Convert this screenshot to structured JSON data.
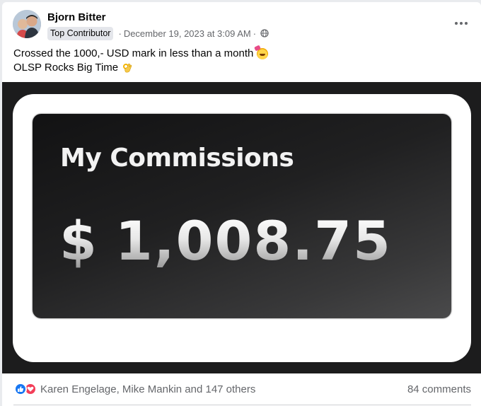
{
  "post": {
    "author": "Bjorn Bitter",
    "badge": "Top Contributor",
    "separator": "·",
    "timestamp": "December 19, 2023 at 3:09 AM",
    "audience_icon": "globe-icon",
    "more_icon": "more-options-icon",
    "text_line1": "Crossed the 1000,- USD mark in less than a month",
    "text_line1_emoji": "partying-face-emoji",
    "text_line2": "OLSP Rocks Big Time",
    "text_line2_emoji": "ok-hand-emoji"
  },
  "media": {
    "title": "My Commissions",
    "currency": "$",
    "amount": "1,008.75"
  },
  "footer": {
    "reaction_icons": [
      "like-icon",
      "love-icon"
    ],
    "reactors": "Karen Engelage, Mike Mankin and 147 others",
    "comments": "84 comments"
  },
  "colors": {
    "like": "#1877f2",
    "love": "#f33e58",
    "secondary_text": "#65676b",
    "badge_bg": "#e4e6eb",
    "media_bg": "#1c1c1d"
  }
}
